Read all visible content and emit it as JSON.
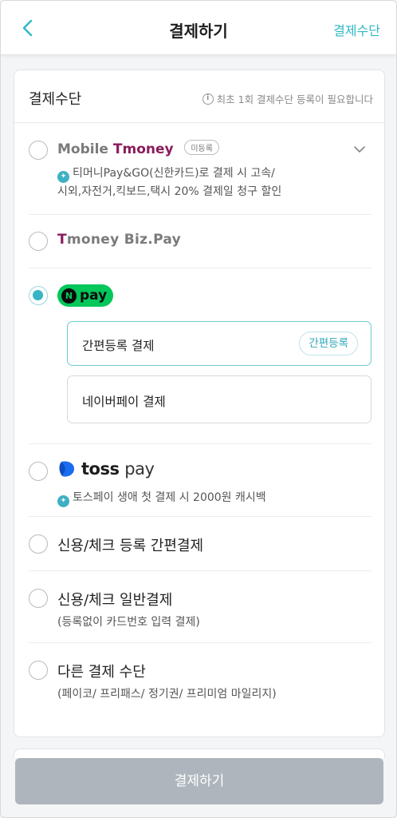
{
  "header": {
    "title": "결제하기",
    "right_link": "결제수단"
  },
  "card": {
    "title": "결제수단",
    "note": "최초 1회 결제수단 등록이 필요합니다"
  },
  "options": {
    "tmoney": {
      "brand_prefix": "Mobile ",
      "brand_t": "T",
      "brand_rest": "money",
      "badge": "미등록",
      "sub_line1": "티머니Pay&GO(신한카드)로 결제 시 고속/",
      "sub_line2": "시외,자전거,킥보드,택시 20% 결제일 청구 할인"
    },
    "tmoney_biz": {
      "brand_t": "T",
      "brand_rest": "money Biz.Pay"
    },
    "npay": {
      "n_letter": "N",
      "pay_text": "pay",
      "simple": {
        "label": "간편등록 결제",
        "pill": "간편등록"
      },
      "naver": {
        "label": "네이버페이 결제"
      }
    },
    "toss": {
      "brand": "toss",
      "pay": "pay",
      "sub": "토스페이 생애 첫 결제 시 2000원 캐시백"
    },
    "credit_simple": {
      "label": "신용/체크 등록 간편결제"
    },
    "credit_general": {
      "label": "신용/체크 일반결제",
      "sub": "(등록없이 카드번호 입력 결제)"
    },
    "other": {
      "label": "다른 결제 수단",
      "sub": "(페이코/ 프리패스/ 정기권/ 프리미엄 마일리지)"
    }
  },
  "footer": {
    "pay_button": "결제하기"
  },
  "colors": {
    "accent": "#36b5c6",
    "npay_green": "#03c75a",
    "tmoney_purple": "#8a1c5c",
    "disabled_button": "#aeb5bd"
  }
}
